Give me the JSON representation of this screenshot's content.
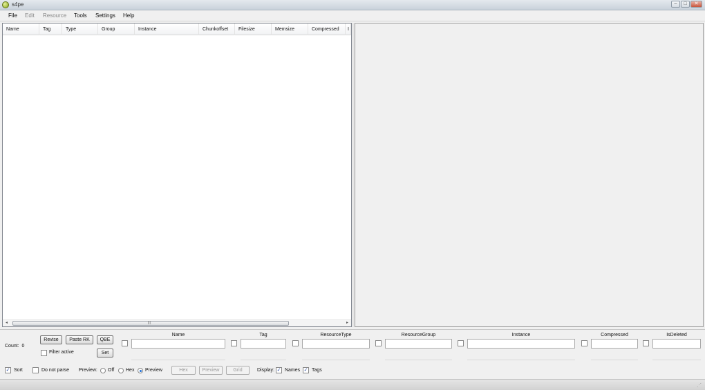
{
  "window": {
    "title": "s4pe"
  },
  "menu": [
    {
      "label": "File",
      "disabled": false
    },
    {
      "label": "Edit",
      "disabled": true
    },
    {
      "label": "Resource",
      "disabled": true
    },
    {
      "label": "Tools",
      "disabled": false
    },
    {
      "label": "Settings",
      "disabled": false
    },
    {
      "label": "Help",
      "disabled": false
    }
  ],
  "list": {
    "columns": [
      "Name",
      "Tag",
      "Type",
      "Group",
      "Instance",
      "Chunkoffset",
      "Filesize",
      "Memsize",
      "Compressed",
      "I"
    ]
  },
  "bottom": {
    "count_label": "Count:",
    "count_value": "0",
    "buttons": {
      "revise": "Revise",
      "paste_rk": "Paste RK",
      "qbe": "QBE",
      "set": "Set"
    },
    "filter_active": "Filter active",
    "filter_fields": [
      "Name",
      "Tag",
      "ResourceType",
      "ResourceGroup",
      "Instance",
      "Compressed",
      "IsDeleted"
    ],
    "sort": "Sort",
    "do_not_parse": "Do not parse",
    "preview_label": "Preview:",
    "preview_off": "Off",
    "preview_hex": "Hex",
    "preview_preview": "Preview",
    "action_buttons": {
      "hex": "Hex",
      "preview": "Preview",
      "grid": "Grid"
    },
    "display_label": "Display:",
    "display_names": "Names",
    "display_tags": "Tags"
  }
}
